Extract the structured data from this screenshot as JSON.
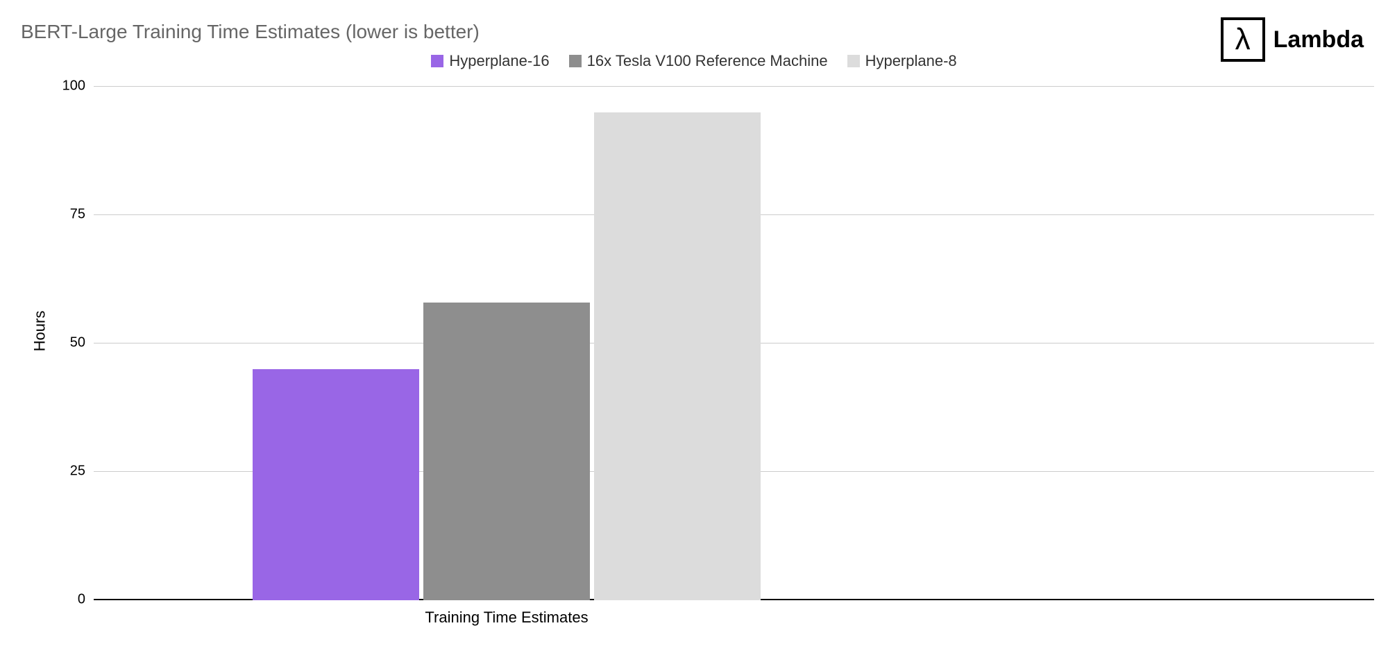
{
  "title": "BERT-Large Training Time Estimates (lower is better)",
  "logo_text": "Lambda",
  "ylabel": "Hours",
  "xlabel": "Training Time Estimates",
  "legend": [
    {
      "label": "Hyperplane-16",
      "color": "#9966e6"
    },
    {
      "label": "16x Tesla V100 Reference Machine",
      "color": "#8e8e8e"
    },
    {
      "label": "Hyperplane-8",
      "color": "#dcdcdc"
    }
  ],
  "y_ticks": [
    "0",
    "25",
    "50",
    "75",
    "100"
  ],
  "chart_data": {
    "type": "bar",
    "categories": [
      "Training Time Estimates"
    ],
    "series": [
      {
        "name": "Hyperplane-16",
        "values": [
          45
        ],
        "color": "#9966e6"
      },
      {
        "name": "16x Tesla V100 Reference Machine",
        "values": [
          58
        ],
        "color": "#8e8e8e"
      },
      {
        "name": "Hyperplane-8",
        "values": [
          95
        ],
        "color": "#dcdcdc"
      }
    ],
    "title": "BERT-Large Training Time Estimates (lower is better)",
    "xlabel": "Training Time Estimates",
    "ylabel": "Hours",
    "ylim": [
      0,
      100
    ]
  }
}
